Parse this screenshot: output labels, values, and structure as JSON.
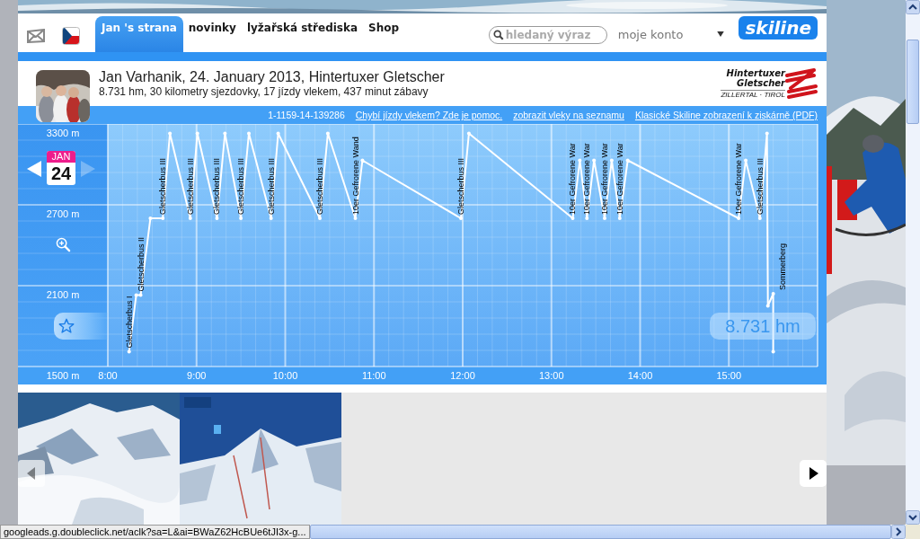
{
  "nav": {
    "tabs": [
      {
        "label": "Jan 's strana",
        "selected": true
      },
      {
        "label": "novinky",
        "selected": false
      },
      {
        "label": "lyžařská střediska",
        "selected": false
      },
      {
        "label": "Shop",
        "selected": false
      }
    ],
    "search": {
      "placeholder": "hledaný výraz"
    },
    "account": "moje konto",
    "logo": "skiline"
  },
  "ride": {
    "title": "Jan Varhanik, 24. January 2013, Hintertuxer Gletscher",
    "summary": "8.731 hm, 30 kilometry sjezdovky, 17 jízdy vlekem, 437 minut zábavy",
    "resort_logo": [
      "Hintertuxer",
      "Gletscher",
      "ZILLERTAL · TIROL"
    ]
  },
  "chart_panel": {
    "ticket": "1-1159-14-139286",
    "links": [
      "Chybí jízdy vlekem? Zde je pomoc.",
      "zobrazit vleky na seznamu",
      "Klasické Skiline zobrazení k ziskárně (PDF)"
    ],
    "date": {
      "month": "JAN",
      "day": "24",
      "prev_disabled": false,
      "next_disabled": true
    },
    "total": "8.731 hm",
    "chart_data": {
      "type": "line",
      "x": [
        8.24,
        8.32,
        8.37,
        8.48,
        8.62,
        8.7,
        8.93,
        9.01,
        9.23,
        9.32,
        9.5,
        9.59,
        9.84,
        9.92,
        10.39,
        10.48,
        10.79,
        10.87,
        11.98,
        12.07,
        13.24,
        13.32,
        13.4,
        13.48,
        13.6,
        13.68,
        13.77,
        13.86,
        15.11,
        15.19,
        15.35,
        15.43,
        15.44,
        15.5,
        15.5
      ],
      "series": [
        {
          "color": "#ffffff",
          "values": [
            1610,
            2030,
            2030,
            2600,
            2600,
            3230,
            2600,
            3230,
            2600,
            3230,
            2600,
            3230,
            2600,
            3230,
            2600,
            3230,
            2600,
            3030,
            2600,
            3230,
            2600,
            3030,
            2600,
            3030,
            2600,
            3030,
            2600,
            3030,
            2600,
            3030,
            2600,
            3230,
            1950,
            2040,
            1610
          ]
        }
      ],
      "xlim": [
        8,
        16
      ],
      "ylim": [
        1500,
        3300
      ],
      "xticks": [
        {
          "value": 8,
          "label": "8:00"
        },
        {
          "value": 9,
          "label": "9:00"
        },
        {
          "value": 10,
          "label": "10:00"
        },
        {
          "value": 11,
          "label": "11:00"
        },
        {
          "value": 12,
          "label": "12:00"
        },
        {
          "value": 13,
          "label": "13:00"
        },
        {
          "value": 14,
          "label": "14:00"
        },
        {
          "value": 15,
          "label": "15:00"
        }
      ],
      "yticks": [
        {
          "value": 3300,
          "label": "3300 m"
        },
        {
          "value": 2700,
          "label": "2700 m"
        },
        {
          "value": 2100,
          "label": "2100 m"
        },
        {
          "value": 1500,
          "label": "1500 m"
        }
      ],
      "grid": true,
      "annotations": [
        {
          "x": 8.24,
          "y": 1610,
          "text": "Gletscherbus I"
        },
        {
          "x": 8.37,
          "y": 2030,
          "text": "Gletscherbus II"
        },
        {
          "x": 8.62,
          "y": 2600,
          "text": "Gletscherbus III"
        },
        {
          "x": 8.93,
          "y": 2600,
          "text": "Gletscherbus III"
        },
        {
          "x": 9.23,
          "y": 2600,
          "text": "Gletscherbus III"
        },
        {
          "x": 9.5,
          "y": 2600,
          "text": "Gletscherbus III"
        },
        {
          "x": 9.84,
          "y": 2600,
          "text": "Gletscherbus III"
        },
        {
          "x": 10.39,
          "y": 2600,
          "text": "Gletscherbus III"
        },
        {
          "x": 10.79,
          "y": 2600,
          "text": "10er Gefrorene Wand"
        },
        {
          "x": 11.98,
          "y": 2600,
          "text": "Gletscherbus III"
        },
        {
          "x": 13.24,
          "y": 2600,
          "text": "10er Gefrorene War"
        },
        {
          "x": 13.4,
          "y": 2600,
          "text": "10er Gefrorene War"
        },
        {
          "x": 13.6,
          "y": 2600,
          "text": "10er Gefrorene War"
        },
        {
          "x": 13.77,
          "y": 2600,
          "text": "10er Gefrorene War"
        },
        {
          "x": 15.11,
          "y": 2600,
          "text": "10er Gefrorene War"
        },
        {
          "x": 15.35,
          "y": 2600,
          "text": "Gletscherbus III"
        },
        {
          "x": 15.5,
          "y": 2040,
          "text": "Sommerberg"
        }
      ]
    }
  },
  "gallery": {
    "prev_disabled": true,
    "next_disabled": false
  },
  "status_bar": "googleads.g.doubleclick.net/aclk?sa=L&ai=BWaZ62HcBUe6tJI3x-g..."
}
